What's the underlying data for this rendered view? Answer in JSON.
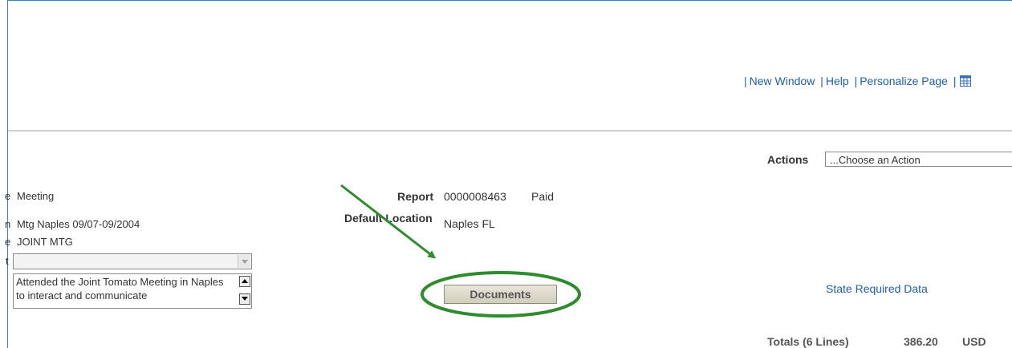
{
  "header_links": {
    "new_window": "New Window",
    "help": "Help",
    "personalize_page": "Personalize Page",
    "separator": "|",
    "icon": "grid-table-icon"
  },
  "actions": {
    "label": "Actions",
    "select_value": "...Choose an Action"
  },
  "left_fields": {
    "meeting_partial_label": "e",
    "meeting_value": "Meeting",
    "description_partial_label": "n",
    "description_value": "Mtg Naples 09/07-09/2004",
    "type_partial_label": "e",
    "type_value": "JOINT MTG",
    "dropdown_partial_label": "t",
    "comment_text": "Attended the Joint Tomato Meeting in Naples to interact and communicate"
  },
  "report": {
    "report_label": "Report",
    "report_number": "0000008463",
    "report_status": "Paid",
    "default_location_label": "Default Location",
    "default_location_value": "Naples FL"
  },
  "documents_button": "Documents",
  "state_required_link": "State Required Data",
  "totals": {
    "label": "Totals (6 Lines)",
    "amount": "386.20",
    "currency": "USD"
  },
  "annotation": {
    "color": "#2e8b2e"
  }
}
